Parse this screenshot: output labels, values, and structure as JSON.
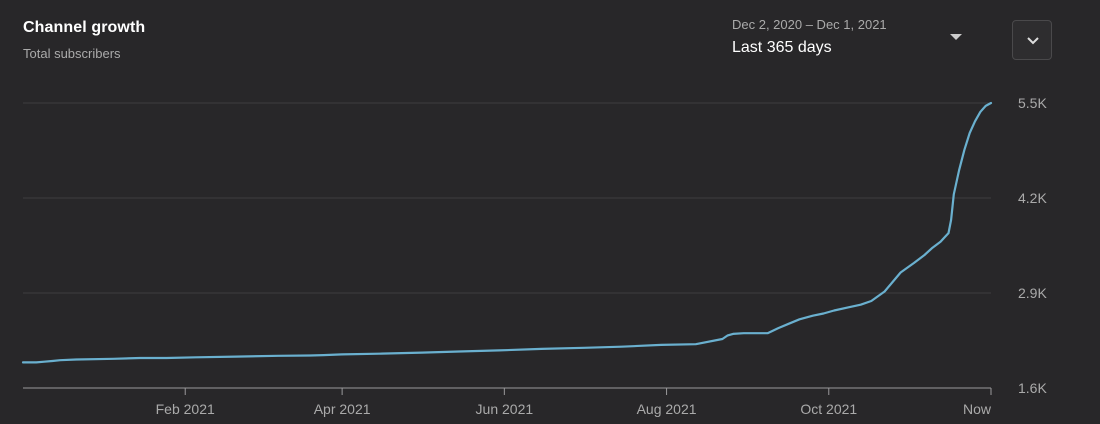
{
  "header": {
    "title": "Channel growth",
    "subtitle": "Total subscribers"
  },
  "range_picker": {
    "dates": "Dec 2, 2020 – Dec 1, 2021",
    "label": "Last 365 days"
  },
  "icons": {
    "range_caret": "caret-down-icon",
    "expand": "chevron-down-icon"
  },
  "colors": {
    "background": "#282729",
    "line": "#6ab0cf",
    "grid": "#3e3d40",
    "baseline": "#9a999b",
    "tick_text": "#aaaaaa"
  },
  "chart_data": {
    "type": "line",
    "title": "Channel growth",
    "subtitle": "Total subscribers",
    "xlabel": "",
    "ylabel": "",
    "ylim": [
      1600,
      5500
    ],
    "yticks": [
      {
        "value": 5500,
        "label": "5.5K"
      },
      {
        "value": 4200,
        "label": "4.2K"
      },
      {
        "value": 2900,
        "label": "2.9K"
      },
      {
        "value": 1600,
        "label": "1.6K"
      }
    ],
    "xlim": [
      "2020-12-02",
      "2021-12-01"
    ],
    "xticks": [
      {
        "date": "2021-02-01",
        "label": "Feb 2021"
      },
      {
        "date": "2021-04-01",
        "label": "Apr 2021"
      },
      {
        "date": "2021-06-01",
        "label": "Jun 2021"
      },
      {
        "date": "2021-08-01",
        "label": "Aug 2021"
      },
      {
        "date": "2021-10-01",
        "label": "Oct 2021"
      },
      {
        "date": "2021-12-01",
        "label": "Now"
      }
    ],
    "grid": true,
    "legend": "none",
    "series": [
      {
        "x": [
          "2020-12-02",
          "2020-12-07",
          "2020-12-10",
          "2020-12-13",
          "2020-12-16",
          "2020-12-22",
          "2021-01-05",
          "2021-01-15",
          "2021-01-25",
          "2021-02-05",
          "2021-02-20",
          "2021-03-08",
          "2021-03-20",
          "2021-03-25",
          "2021-04-01",
          "2021-04-15",
          "2021-05-01",
          "2021-05-15",
          "2021-05-30",
          "2021-06-15",
          "2021-07-01",
          "2021-07-15",
          "2021-07-30",
          "2021-08-12",
          "2021-08-22",
          "2021-08-24",
          "2021-08-26",
          "2021-08-30",
          "2021-09-08",
          "2021-09-12",
          "2021-09-16",
          "2021-09-20",
          "2021-09-25",
          "2021-09-29",
          "2021-10-03",
          "2021-10-08",
          "2021-10-13",
          "2021-10-17",
          "2021-10-22",
          "2021-10-25",
          "2021-10-28",
          "2021-11-02",
          "2021-11-06",
          "2021-11-09",
          "2021-11-12",
          "2021-11-14",
          "2021-11-15",
          "2021-11-16",
          "2021-11-17",
          "2021-11-19",
          "2021-11-21",
          "2021-11-23",
          "2021-11-25",
          "2021-11-27",
          "2021-11-29",
          "2021-12-01"
        ],
        "y": [
          1950,
          1950,
          1960,
          1970,
          1980,
          1990,
          2000,
          2010,
          2010,
          2020,
          2030,
          2040,
          2045,
          2050,
          2060,
          2070,
          2085,
          2100,
          2115,
          2135,
          2150,
          2165,
          2190,
          2200,
          2270,
          2320,
          2340,
          2350,
          2350,
          2420,
          2480,
          2540,
          2590,
          2620,
          2660,
          2700,
          2740,
          2790,
          2920,
          3050,
          3180,
          3310,
          3420,
          3520,
          3600,
          3680,
          3720,
          3900,
          4250,
          4580,
          4860,
          5090,
          5250,
          5380,
          5460,
          5500
        ]
      }
    ]
  }
}
